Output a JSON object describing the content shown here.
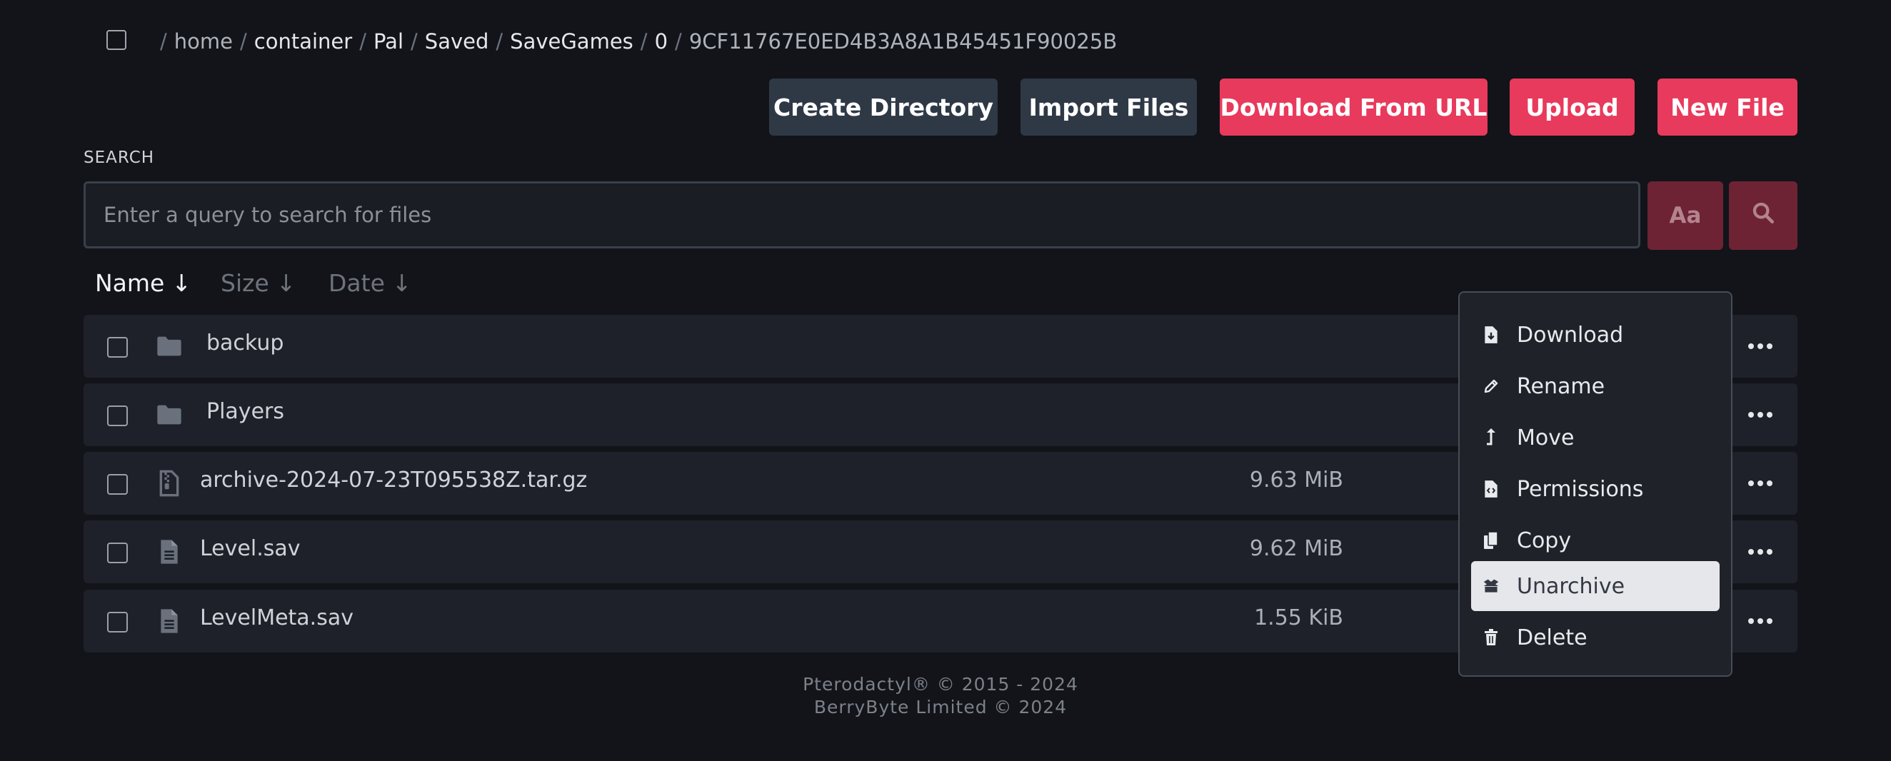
{
  "breadcrumb": {
    "segments": [
      "home",
      "container",
      "Pal",
      "Saved",
      "SaveGames",
      "0",
      "9CF11767E0ED4B3A8A1B45451F90025B"
    ]
  },
  "toolbar": {
    "create_directory": "Create Directory",
    "import_files": "Import Files",
    "download_from_url": "Download From URL",
    "upload": "Upload",
    "new_file": "New File"
  },
  "search": {
    "label": "SEARCH",
    "placeholder": "Enter a query to search for files",
    "case_toggle": "Aa",
    "search_icon": "search-icon"
  },
  "sort": {
    "name": "Name",
    "size": "Size",
    "date": "Date",
    "arrow": "↓",
    "active": "Name"
  },
  "files": [
    {
      "name": "backup",
      "size": "",
      "type": "folder",
      "icon": "folder-icon"
    },
    {
      "name": "Players",
      "size": "",
      "type": "folder",
      "icon": "folder-icon"
    },
    {
      "name": "archive-2024-07-23T095538Z.tar.gz",
      "size": "9.63 MiB",
      "type": "archive",
      "icon": "archive-file-icon"
    },
    {
      "name": "Level.sav",
      "size": "9.62 MiB",
      "type": "file",
      "icon": "file-text-icon"
    },
    {
      "name": "LevelMeta.sav",
      "size": "1.55 KiB",
      "type": "file",
      "icon": "file-text-icon"
    }
  ],
  "context_menu": {
    "items": [
      {
        "label": "Download",
        "icon": "file-download-icon"
      },
      {
        "label": "Rename",
        "icon": "pencil-icon"
      },
      {
        "label": "Move",
        "icon": "level-up-icon"
      },
      {
        "label": "Permissions",
        "icon": "file-code-icon"
      },
      {
        "label": "Copy",
        "icon": "copy-icon"
      },
      {
        "label": "Unarchive",
        "icon": "box-open-icon"
      },
      {
        "label": "Delete",
        "icon": "trash-icon"
      }
    ],
    "highlighted": "Unarchive"
  },
  "footer": {
    "line1": "Pterodactyl® © 2015 - 2024",
    "line2": "BerryByte Limited © 2024"
  },
  "colors": {
    "background": "#121419",
    "row": "#1e2129",
    "accent_red": "#e83a5c",
    "button_dark": "#2f3946"
  }
}
